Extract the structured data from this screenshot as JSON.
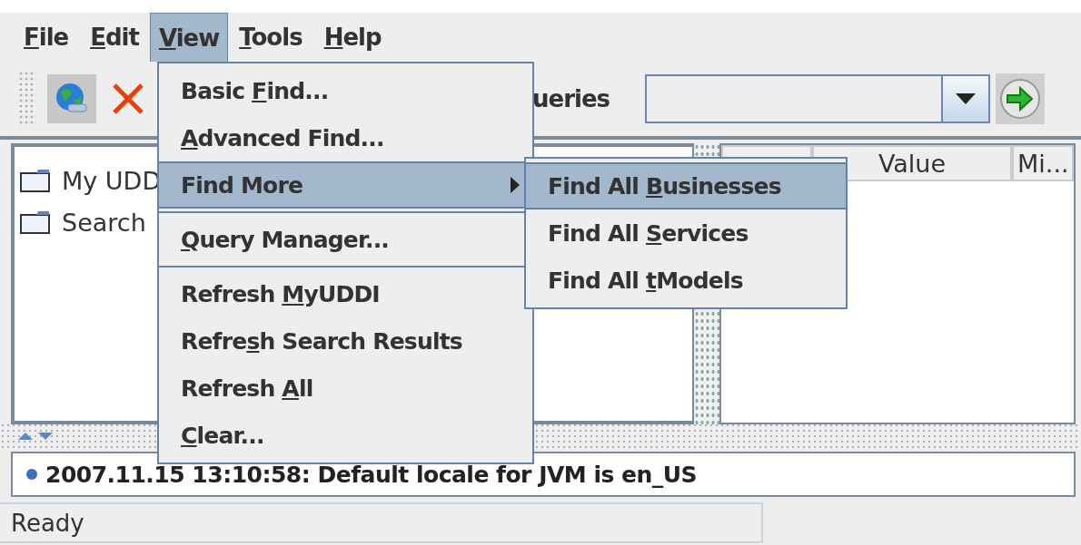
{
  "menubar": [
    {
      "key": "F",
      "after": "ile",
      "selected": false
    },
    {
      "key": "E",
      "after": "dit",
      "selected": false
    },
    {
      "key": "V",
      "after": "iew",
      "selected": true
    },
    {
      "key": "T",
      "after": "ools",
      "selected": false
    },
    {
      "key": "H",
      "after": "elp",
      "selected": false
    }
  ],
  "toolbar": {
    "queries_label": "ueries"
  },
  "tree": {
    "items": [
      "My UDD",
      "Search"
    ]
  },
  "table": {
    "columns": [
      "Value",
      "Mi..."
    ]
  },
  "log": {
    "text": "2007.11.15 13:10:58: Default locale for JVM is en_US"
  },
  "status_bar": {
    "text": "Ready"
  },
  "menu": {
    "items": [
      {
        "kind": "item",
        "before": "Basic ",
        "key": "F",
        "after": "ind...",
        "selected": false
      },
      {
        "kind": "item",
        "key": "A",
        "after": "dvanced Find...",
        "selected": false
      },
      {
        "kind": "submenu",
        "before": "Find More",
        "selected": true
      },
      {
        "kind": "separator"
      },
      {
        "kind": "item",
        "key": "Q",
        "after": "uery Manager...",
        "selected": false
      },
      {
        "kind": "separator"
      },
      {
        "kind": "item",
        "before": "Refresh ",
        "key": "M",
        "after": "yUDDI",
        "selected": false
      },
      {
        "kind": "item",
        "before": "Refre",
        "key": "s",
        "after": "h Search Results",
        "selected": false
      },
      {
        "kind": "item",
        "before": "Refresh ",
        "key": "A",
        "after": "ll",
        "selected": false
      },
      {
        "kind": "item",
        "key": "C",
        "after": "lear...",
        "selected": false
      }
    ]
  },
  "submenu": {
    "items": [
      {
        "before": "Find All ",
        "key": "B",
        "after": "usinesses",
        "selected": true
      },
      {
        "before": "Find All ",
        "key": "S",
        "after": "ervices",
        "selected": false
      },
      {
        "before": "Find All ",
        "key": "t",
        "after": "Models",
        "selected": false
      }
    ]
  }
}
